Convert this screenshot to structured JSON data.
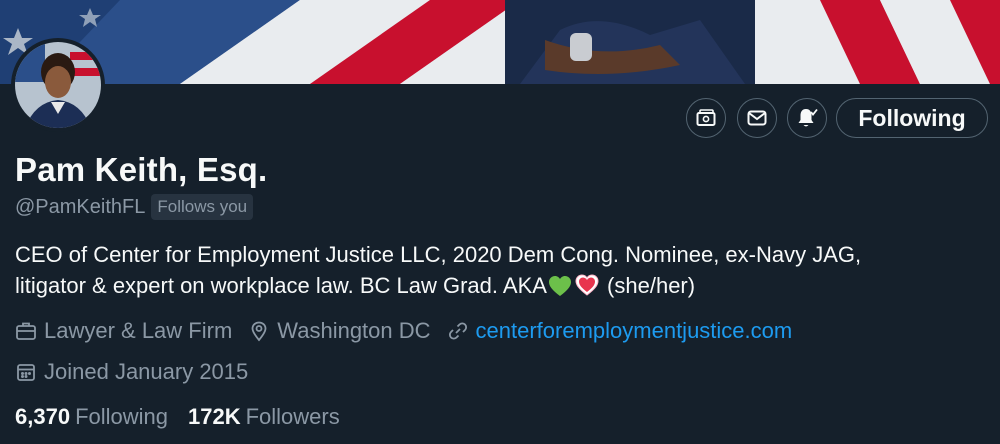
{
  "profile": {
    "display_name": "Pam Keith, Esq.",
    "handle": "@PamKeithFL",
    "follows_you": "Follows you",
    "bio_line1": "CEO of Center for Employment Justice LLC, 2020 Dem Cong. Nominee, ex-Navy JAG,",
    "bio_line2_prefix": "litigator & expert on workplace law. BC Law Grad. AKA",
    "bio_line2_suffix": "(she/her)",
    "category": "Lawyer & Law Firm",
    "location": "Washington DC",
    "website": "centerforemploymentjustice.com",
    "joined": "Joined January 2015"
  },
  "stats": {
    "following_count": "6,370",
    "following_label": "Following",
    "followers_count": "172K",
    "followers_label": "Followers"
  },
  "actions": {
    "follow_state_label": "Following",
    "icons": [
      "subscription-icon",
      "message-icon",
      "notification-bell-icon"
    ]
  },
  "colors": {
    "background": "#15202b",
    "text_primary": "#f7f9f9",
    "text_secondary": "#8b98a5",
    "link": "#1d9bf0",
    "border": "#536471"
  }
}
